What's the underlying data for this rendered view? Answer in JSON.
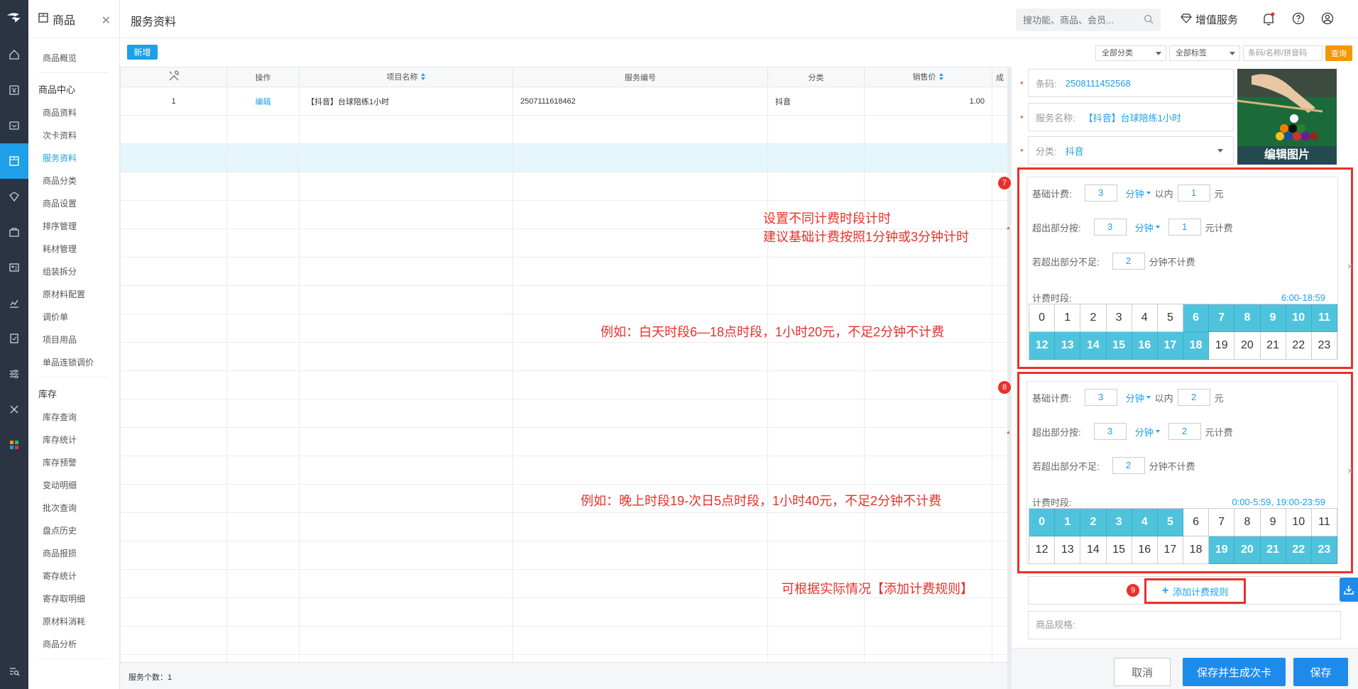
{
  "app": {
    "module_title": "商品",
    "page_title": "服务资料"
  },
  "header": {
    "search_placeholder": "搜功能、商品、会员...",
    "vas_label": "增值服务"
  },
  "subnav": {
    "item_overview": "商品概览",
    "group_center": "商品中心",
    "center_items": [
      "商品资料",
      "次卡资料",
      "服务资料",
      "商品分类",
      "商品设置",
      "排序管理",
      "耗材管理",
      "组装拆分",
      "原材料配置",
      "调价单",
      "项目用品",
      "单品连锁调价"
    ],
    "group_stock": "库存",
    "stock_items": [
      "库存查询",
      "库存统计",
      "库存预警",
      "变动明细",
      "批次查询",
      "盘点历史",
      "商品报损",
      "寄存统计",
      "寄存取明细",
      "原材料消耗",
      "商品分析"
    ]
  },
  "toolbar": {
    "new_label": "新增",
    "category_select": "全部分类",
    "tag_select": "全部标签",
    "search_placeholder": "条码/名称/拼音码",
    "query_label": "查询"
  },
  "table": {
    "columns": [
      "",
      "操作",
      "项目名称",
      "服务编号",
      "分类",
      "销售价",
      "成"
    ],
    "rows": [
      {
        "index": "1",
        "action": "编辑",
        "name": "【抖音】台球陪练1小时",
        "code": "2507111618462",
        "category": "抖音",
        "price": "1.00"
      }
    ],
    "footer": "服务个数：1"
  },
  "annotations": {
    "line1": "设置不同计费时段计时",
    "line2": "建议基础计费按照1分钟或3分钟计时",
    "example_day": "例如：白天时段6—18点时段，1小时20元，不足2分钟不计费",
    "example_night": "例如：晚上时段19-次日5点时段，1小时40元，不足2分钟不计费",
    "add_hint": "可根据实际情况【添加计费规则】"
  },
  "panel": {
    "barcode_label": "条码:",
    "barcode_value": "2508111452568",
    "name_label": "服务名称:",
    "name_value": "【抖音】台球陪练1小时",
    "category_label": "分类:",
    "category_value": "抖音",
    "edit_image": "编辑图片",
    "rule_labels": {
      "base": "基础计费:",
      "within": "以内",
      "yuan": "元",
      "over": "超出部分按:",
      "yuan_charge": "元计费",
      "short": "若超出部分不足:",
      "short_suffix": "分钟不计费",
      "period": "计费时段:",
      "unit": "分钟"
    },
    "rules": [
      {
        "badge": "7",
        "base_minutes": "3",
        "base_price": "1",
        "over_minutes": "3",
        "over_price": "1",
        "short_minutes": "2",
        "period": "6:00-18:59",
        "active_hours": [
          6,
          7,
          8,
          9,
          10,
          11,
          12,
          13,
          14,
          15,
          16,
          17,
          18
        ]
      },
      {
        "badge": "8",
        "base_minutes": "3",
        "base_price": "2",
        "over_minutes": "3",
        "over_price": "2",
        "short_minutes": "2",
        "period": "0:00-5:59, 19:00-23:59",
        "active_hours": [
          0,
          1,
          2,
          3,
          4,
          5,
          19,
          20,
          21,
          22,
          23
        ]
      }
    ],
    "add_badge": "9",
    "add_rule_label": "添加计费规则",
    "spec_label": "商品规格:",
    "cancel_label": "取消",
    "save_card_label": "保存并生成次卡",
    "save_label": "保存"
  },
  "colors": {
    "accent": "#1e9fe8",
    "rail": "#2b3442",
    "annotation": "#e8312a",
    "hour_active": "#4fc3dc",
    "query": "#f39800"
  }
}
